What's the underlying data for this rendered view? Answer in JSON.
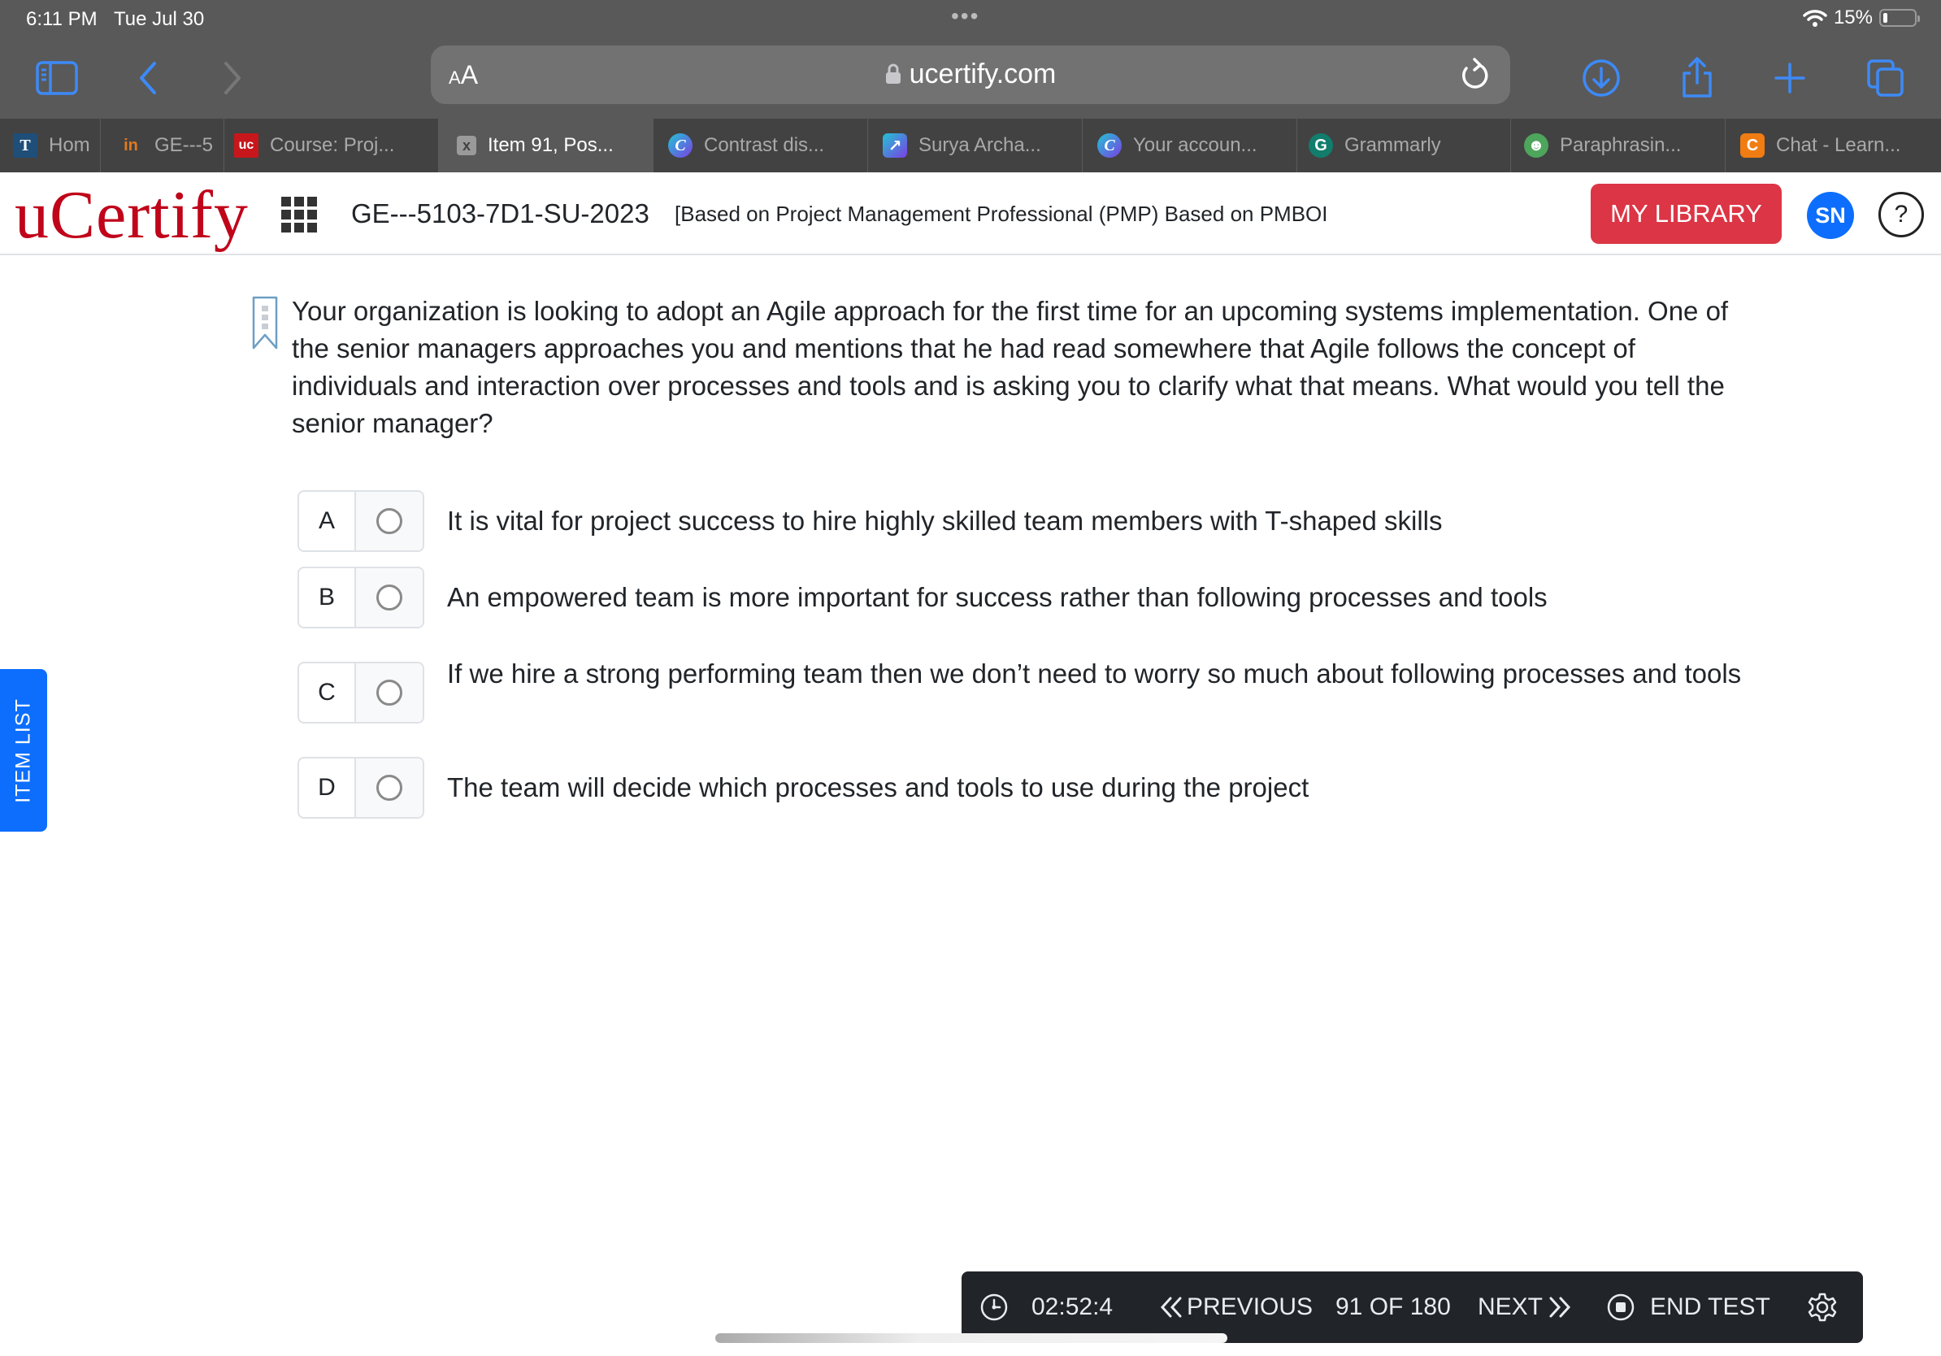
{
  "status_bar": {
    "time": "6:11 PM",
    "date": "Tue Jul 30",
    "battery": "15%"
  },
  "browser": {
    "text_size_label": "AA",
    "url": "ucertify.com",
    "tabs": [
      {
        "label": "Hom",
        "icon": "T",
        "color": "#1f4e79"
      },
      {
        "label": "GE---5",
        "icon": "in",
        "color": "#e07a1f"
      },
      {
        "label": "Course: Proj...",
        "icon": "uc",
        "color": "#c7171c"
      },
      {
        "label": "Item 91, Pos...",
        "icon": "x",
        "color": "#9a9a9a",
        "active": true
      },
      {
        "label": "Contrast dis...",
        "icon": "C",
        "color": "#5b4fe3"
      },
      {
        "label": "Surya Archa...",
        "icon": "↗",
        "color": "#6a3de8"
      },
      {
        "label": "Your accoun...",
        "icon": "C",
        "color": "#5b4fe3"
      },
      {
        "label": "Grammarly",
        "icon": "G",
        "color": "#127d6c"
      },
      {
        "label": "Paraphrasin...",
        "icon": "☻",
        "color": "#4ea55c"
      },
      {
        "label": "Chat - Learn...",
        "icon": "C",
        "color": "#f07c12"
      }
    ]
  },
  "header": {
    "logo": "uCertify",
    "course_code": "GE---5103-7D1-SU-2023",
    "course_name": "[Based on Project Management Professional (PMP) Based on PMBOI",
    "my_library_label": "MY LIBRARY",
    "avatar_initials": "SN",
    "help_label": "?"
  },
  "side_tab": {
    "label": "ITEM LIST"
  },
  "question": {
    "text": "Your organization is looking to adopt an Agile approach for the first time for an upcoming systems implementation. One of the senior managers approaches you and mentions that he had read somewhere that Agile follows the concept of individuals and interaction over processes and tools and is asking you to clarify what that means. What would you tell the senior manager?",
    "options": [
      {
        "letter": "A",
        "text": "It is vital for project success to hire highly skilled team members with T-shaped skills",
        "selected": false
      },
      {
        "letter": "B",
        "text": "An empowered team is more important for success rather than following processes and tools",
        "selected": false
      },
      {
        "letter": "C",
        "text": "If we hire a strong performing team then we don’t need to worry so much about following processes and tools",
        "selected": false
      },
      {
        "letter": "D",
        "text": "The team will decide which processes and tools to use during the project",
        "selected": false
      }
    ]
  },
  "footer": {
    "timer": "02:52:4",
    "previous_label": "PREVIOUS",
    "position": "91 OF 180",
    "next_label": "NEXT",
    "end_test_label": "END TEST"
  },
  "colors": {
    "brand_red": "#c0041a",
    "library_red": "#dc3545",
    "primary_blue": "#0d6efd",
    "safari_blue": "#3d8af7"
  }
}
